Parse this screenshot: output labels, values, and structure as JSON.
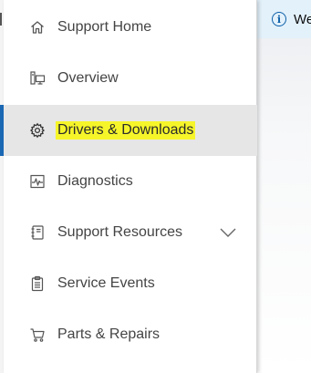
{
  "banner": {
    "text": "We",
    "icon": "info-icon"
  },
  "menu": {
    "items": [
      {
        "label": "Support Home",
        "icon": "home-icon",
        "active": false
      },
      {
        "label": "Overview",
        "icon": "computer-icon",
        "active": false
      },
      {
        "label": "Drivers & Downloads",
        "icon": "gear-icon",
        "active": true,
        "highlighted": true
      },
      {
        "label": "Diagnostics",
        "icon": "pulse-icon",
        "active": false
      },
      {
        "label": "Support Resources",
        "icon": "book-icon",
        "active": false,
        "expandable": true
      },
      {
        "label": "Service Events",
        "icon": "clipboard-icon",
        "active": false
      },
      {
        "label": "Parts & Repairs",
        "icon": "cart-icon",
        "active": false
      }
    ]
  },
  "colors": {
    "accent": "#1a67b3",
    "highlight": "#f6f52a",
    "active_bg": "#e6e6e6",
    "banner_bg": "#e3f1fb"
  }
}
